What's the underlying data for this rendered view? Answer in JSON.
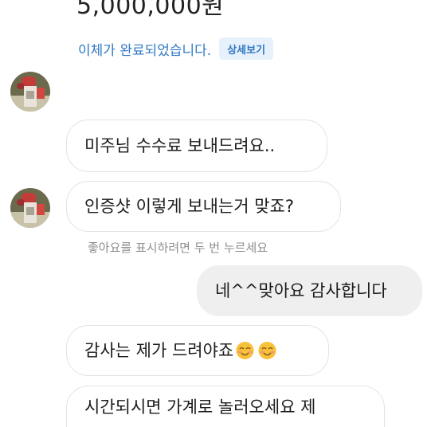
{
  "transfer": {
    "amount": "5,000,000원",
    "status": "이체가 완료되었습니다.",
    "detail_label": "상세보기"
  },
  "messages": [
    {
      "text": "미주님 수수료 보내드려요.."
    },
    {
      "text": "인증샷 이렇게 보내는거 맞죠?"
    },
    {
      "text": "네^^맞아요 감사합니다"
    },
    {
      "text": "감사는 제가 드려야죠"
    },
    {
      "text": "시간되시면 가계로 놀러오세요 제"
    }
  ],
  "like_hint": "좋아요를 표시하려면 두 번 누르세요",
  "colors": {
    "link": "#2f78c4",
    "detail_bg": "#e7f1fb",
    "outgoing_bg": "#efefef",
    "incoming_border": "#e3e3e3"
  }
}
